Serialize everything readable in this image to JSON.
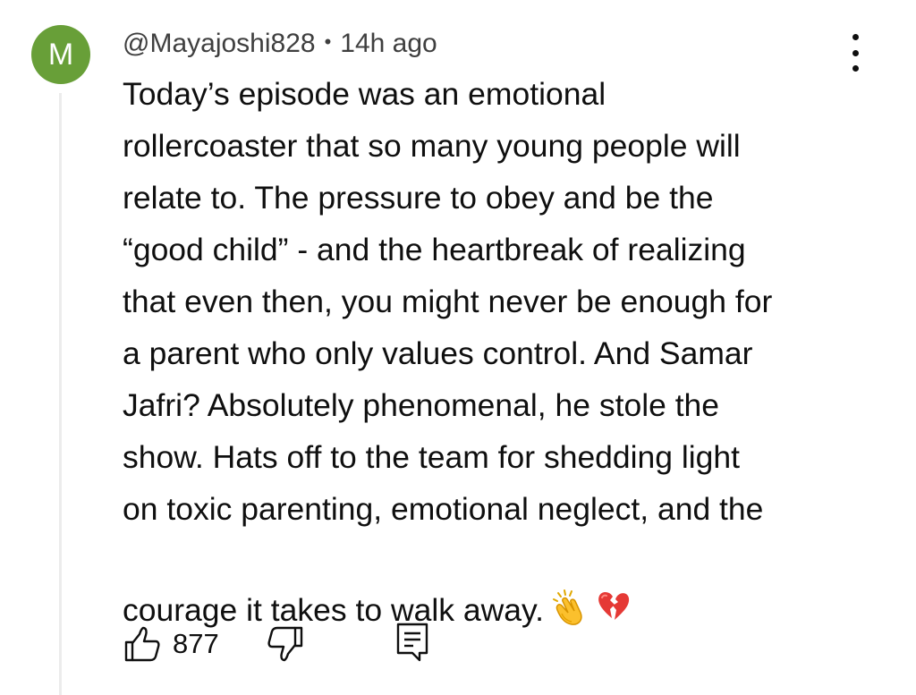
{
  "comment": {
    "avatar_letter": "M",
    "avatar_color": "#689f38",
    "username": "@Mayajoshi828",
    "separator": "•",
    "time_ago": "14h ago",
    "text": "Today’s episode was an emotional\nrollercoaster that so many young people will\nrelate to. The pressure to obey and be the\n“good child” - and the heartbreak of realizing\nthat even then, you might never be enough for\na parent who only values control. And Samar\nJafri? Absolutely phenomenal, he stole the\nshow. Hats off to the team for shedding light\non toxic parenting, emotional neglect, and the\ncourage it takes to walk away.",
    "emojis": [
      "clapping-hands",
      "broken-heart"
    ]
  },
  "actions": {
    "like_count": "877",
    "icons": [
      "thumbs-up-icon",
      "thumbs-down-icon",
      "reply-icon",
      "more-vert-icon"
    ]
  }
}
